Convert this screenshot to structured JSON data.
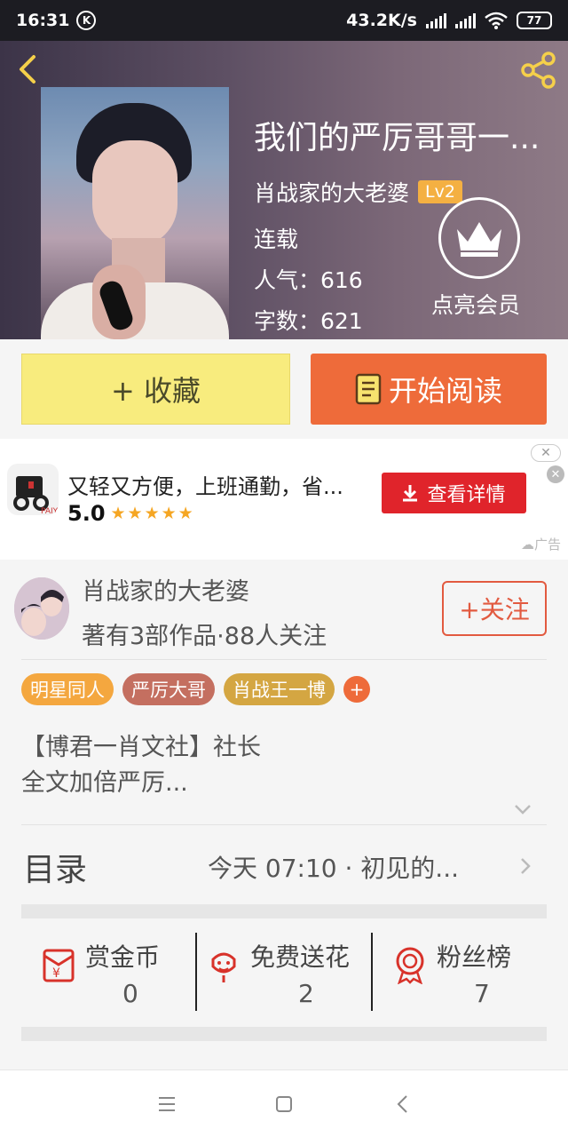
{
  "status_bar": {
    "time": "16:31",
    "k_icon": "K",
    "network_speed": "43.2K/s",
    "battery": "77"
  },
  "book": {
    "title": "我们的严厉哥哥一...",
    "author": "肖战家的大老婆",
    "author_level": "Lv2",
    "status": "连载",
    "popularity": "人气：616",
    "word_count": "字数：621",
    "vip_label": "点亮会员"
  },
  "actions": {
    "favorite": "+ 收藏",
    "read": "开始阅读"
  },
  "ad": {
    "title": "又轻又方便，上班通勤，省...",
    "rating": "5.0",
    "stars": "★★★★★",
    "cta": "查看详情",
    "label": "广告",
    "close": "✕"
  },
  "author_card": {
    "name": "肖战家的大老婆",
    "stats": "著有3部作品·88人关注",
    "follow": "+关注"
  },
  "tags": [
    {
      "label": "明星同人",
      "color": "#f4a73f"
    },
    {
      "label": "严厉大哥",
      "color": "#c46f60"
    },
    {
      "label": "肖战王一博",
      "color": "#d4a642"
    }
  ],
  "tag_add": "+",
  "description": {
    "line1": "【博君一肖文社】社长",
    "line2": "全文加倍严厉..."
  },
  "toc": {
    "label": "目录",
    "latest": "今天 07:10 · 初见的..."
  },
  "stats": [
    {
      "label": "赏金币",
      "value": "0",
      "icon": "red-envelope-icon"
    },
    {
      "label": "免费送花",
      "value": "2",
      "icon": "flower-icon"
    },
    {
      "label": "粉丝榜",
      "value": "7",
      "icon": "medal-icon"
    }
  ],
  "colors": {
    "accent_orange": "#ee6b3a",
    "favorite_yellow": "#f8ec7e",
    "ad_red": "#e0242b",
    "lv_badge": "#f4b042"
  }
}
